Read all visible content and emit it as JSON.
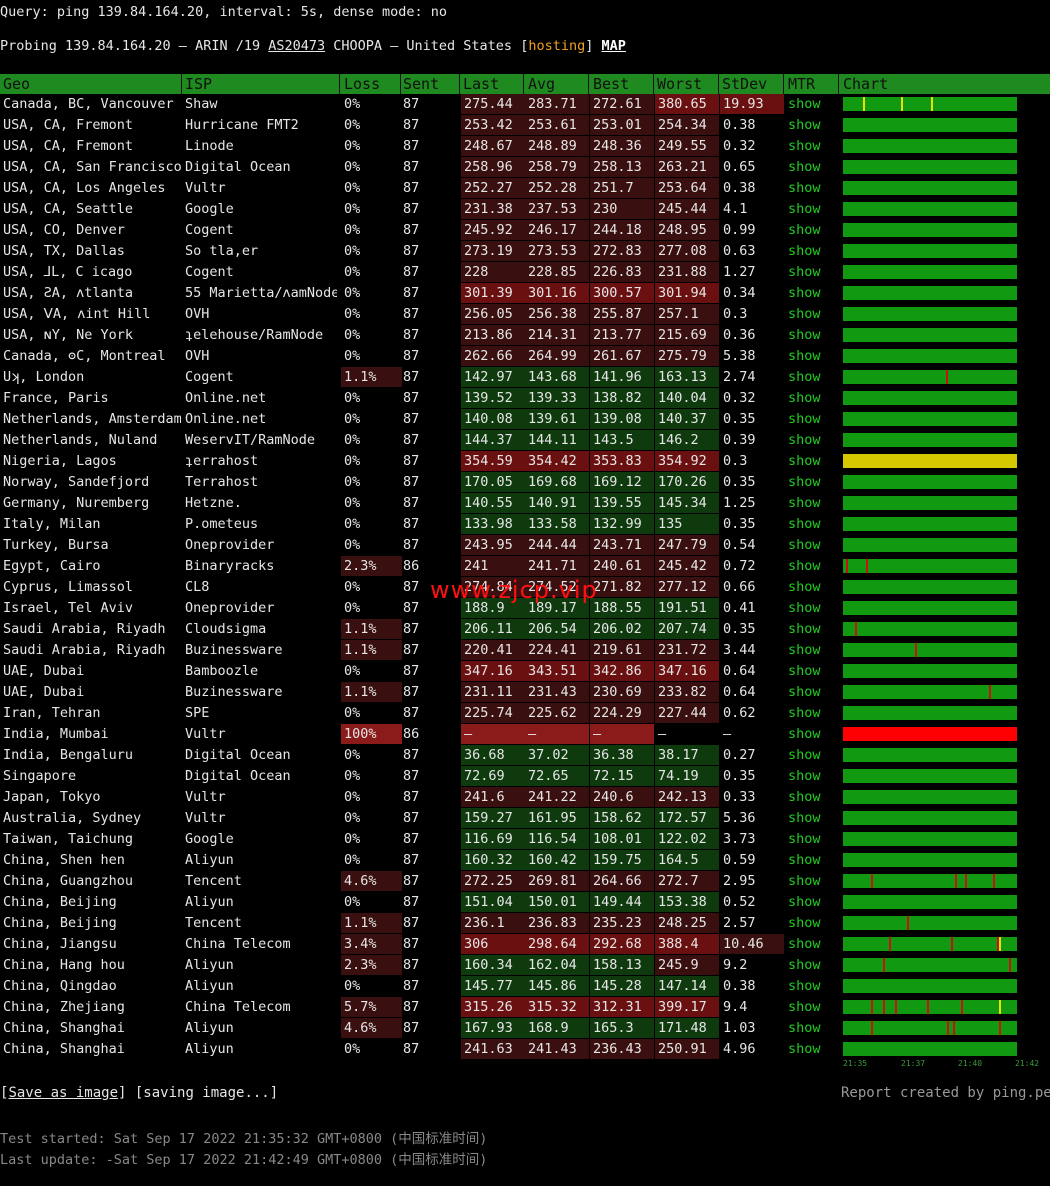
{
  "query": "Query: ping 139.84.164.20, interval: 5s, dense mode: no",
  "probe": {
    "prefix": "Probing 139.84.164.20 — ARIN /19 ",
    "asn": "AS20473",
    "mid": " CHOOPA — United States [",
    "tag": "hosting",
    "suffix": "] ",
    "map": "MAP"
  },
  "columns": [
    "Geo",
    "ISP",
    "Loss",
    "Sent",
    "Last",
    "Avg",
    "Best",
    "Worst",
    "StDev",
    "MTR",
    "Chart"
  ],
  "colors": {
    "good": "#0e3a0e",
    "mid": "#3a0f0f",
    "bad": "#6b1010",
    "worse": "#8b1a1a",
    "green": "#119911",
    "yellow": "#d4c800",
    "red": "#ff0000"
  },
  "rows": [
    {
      "geo": "Canada, BC, Vancouver",
      "isp": "Shaw",
      "loss": "0%",
      "sent": "87",
      "last": "275.44",
      "avg": "283.71",
      "best": "272.61",
      "worst": "380.65",
      "std": "19.93",
      "mtr": "show",
      "lc": "mid",
      "wc": "bad",
      "sc": "bad",
      "bar": "green",
      "spikes": [
        [
          20,
          "yellow"
        ],
        [
          58,
          "yellow"
        ],
        [
          88,
          "yellow"
        ]
      ]
    },
    {
      "geo": "USA, CA, Fremont",
      "isp": "Hurricane FMT2",
      "loss": "0%",
      "sent": "87",
      "last": "253.42",
      "avg": "253.61",
      "best": "253.01",
      "worst": "254.34",
      "std": "0.38",
      "mtr": "show",
      "lc": "mid",
      "wc": "mid",
      "bar": "green",
      "spikes": []
    },
    {
      "geo": "USA, CA, Fremont",
      "isp": "Linode",
      "loss": "0%",
      "sent": "87",
      "last": "248.67",
      "avg": "248.89",
      "best": "248.36",
      "worst": "249.55",
      "std": "0.32",
      "mtr": "show",
      "lc": "mid",
      "wc": "mid",
      "bar": "green",
      "spikes": []
    },
    {
      "geo": "USA, CA, San Francisco",
      "isp": "Digital Ocean",
      "loss": "0%",
      "sent": "87",
      "last": "258.96",
      "avg": "258.79",
      "best": "258.13",
      "worst": "263.21",
      "std": "0.65",
      "mtr": "show",
      "lc": "mid",
      "wc": "mid",
      "bar": "green",
      "spikes": []
    },
    {
      "geo": "USA, CA, Los Angeles",
      "isp": "Vultr",
      "loss": "0%",
      "sent": "87",
      "last": "252.27",
      "avg": "252.28",
      "best": "251.7",
      "worst": "253.64",
      "std": "0.38",
      "mtr": "show",
      "lc": "mid",
      "wc": "mid",
      "bar": "green",
      "spikes": []
    },
    {
      "geo": "USA, CA, Seattle",
      "isp": "Google",
      "loss": "0%",
      "sent": "87",
      "last": "231.38",
      "avg": "237.53",
      "best": "230",
      "worst": "245.44",
      "std": "4.1",
      "mtr": "show",
      "lc": "mid",
      "wc": "mid",
      "bar": "green",
      "spikes": []
    },
    {
      "geo": "USA, CO, Denver",
      "isp": "Cogent",
      "loss": "0%",
      "sent": "87",
      "last": "245.92",
      "avg": "246.17",
      "best": "244.18",
      "worst": "248.95",
      "std": "0.99",
      "mtr": "show",
      "lc": "mid",
      "wc": "mid",
      "bar": "green",
      "spikes": []
    },
    {
      "geo": "USA, TX, Dallas",
      "isp": "So tla,er",
      "loss": "0%",
      "sent": "87",
      "last": "273.19",
      "avg": "273.53",
      "best": "272.83",
      "worst": "277.08",
      "std": "0.63",
      "mtr": "show",
      "lc": "mid",
      "wc": "mid",
      "bar": "green",
      "spikes": []
    },
    {
      "geo": "USA, ⅃L, C icago",
      "isp": "Cogent",
      "loss": "0%",
      "sent": "87",
      "last": "228",
      "avg": "228.85",
      "best": "226.83",
      "worst": "231.88",
      "std": "1.27",
      "mtr": "show",
      "lc": "mid",
      "wc": "mid",
      "bar": "green",
      "spikes": []
    },
    {
      "geo": "USA, ƧA, ʌtlanta",
      "isp": "55 Marietta/ʌamNode",
      "loss": "0%",
      "sent": "87",
      "last": "301.39",
      "avg": "301.16",
      "best": "300.57",
      "worst": "301.94",
      "std": "0.34",
      "mtr": "show",
      "lc": "bad",
      "wc": "bad",
      "bar": "green",
      "spikes": []
    },
    {
      "geo": "USA, ⅤA, ʌint Hill",
      "isp": "OVH",
      "loss": "0%",
      "sent": "87",
      "last": "256.05",
      "avg": "256.38",
      "best": "255.87",
      "worst": "257.1",
      "std": "0.3",
      "mtr": "show",
      "lc": "mid",
      "wc": "mid",
      "bar": "green",
      "spikes": []
    },
    {
      "geo": "USA, ɴY, Ne  York",
      "isp": "ʇelehouse/RamNode",
      "loss": "0%",
      "sent": "87",
      "last": "213.86",
      "avg": "214.31",
      "best": "213.77",
      "worst": "215.69",
      "std": "0.36",
      "mtr": "show",
      "lc": "mid",
      "wc": "mid",
      "bar": "green",
      "spikes": []
    },
    {
      "geo": "Canada, ʘC, Montreal",
      "isp": "OVH",
      "loss": "0%",
      "sent": "87",
      "last": "262.66",
      "avg": "264.99",
      "best": "261.67",
      "worst": "275.79",
      "std": "5.38",
      "mtr": "show",
      "lc": "mid",
      "wc": "mid",
      "bar": "green",
      "spikes": []
    },
    {
      "geo": "Uʞ, London",
      "isp": "Cogent",
      "loss": "1.1%",
      "sent": "87",
      "last": "142.97",
      "avg": "143.68",
      "best": "141.96",
      "worst": "163.13",
      "std": "2.74",
      "mtr": "show",
      "lc": "good",
      "wc": "good",
      "lossc": "mid",
      "bar": "green",
      "spikes": [
        [
          103,
          "red"
        ]
      ]
    },
    {
      "geo": "France, Paris",
      "isp": "Online.net",
      "loss": "0%",
      "sent": "87",
      "last": "139.52",
      "avg": "139.33",
      "best": "138.82",
      "worst": "140.04",
      "std": "0.32",
      "mtr": "show",
      "lc": "good",
      "wc": "good",
      "bar": "green",
      "spikes": []
    },
    {
      "geo": "Netherlands, Amsterdam",
      "isp": "Online.net",
      "loss": "0%",
      "sent": "87",
      "last": "140.08",
      "avg": "139.61",
      "best": "139.08",
      "worst": "140.37",
      "std": "0.35",
      "mtr": "show",
      "lc": "good",
      "wc": "good",
      "bar": "green",
      "spikes": []
    },
    {
      "geo": "Netherlands, Nuland",
      "isp": "WeservIT/RamNode",
      "loss": "0%",
      "sent": "87",
      "last": "144.37",
      "avg": "144.11",
      "best": "143.5",
      "worst": "146.2",
      "std": "0.39",
      "mtr": "show",
      "lc": "good",
      "wc": "good",
      "bar": "green",
      "spikes": []
    },
    {
      "geo": "Nigeria, Lagos",
      "isp": "ʇerrahost",
      "loss": "0%",
      "sent": "87",
      "last": "354.59",
      "avg": "354.42",
      "best": "353.83",
      "worst": "354.92",
      "std": "0.3",
      "mtr": "show",
      "lc": "bad",
      "wc": "bad",
      "bar": "yellow",
      "spikes": []
    },
    {
      "geo": "Norway, Sandefjord",
      "isp": "Terrahost",
      "loss": "0%",
      "sent": "87",
      "last": "170.05",
      "avg": "169.68",
      "best": "169.12",
      "worst": "170.26",
      "std": "0.35",
      "mtr": "show",
      "lc": "good",
      "wc": "good",
      "bar": "green",
      "spikes": []
    },
    {
      "geo": "Germany, Nuremberg",
      "isp": "Hetzne.",
      "loss": "0%",
      "sent": "87",
      "last": "140.55",
      "avg": "140.91",
      "best": "139.55",
      "worst": "145.34",
      "std": "1.25",
      "mtr": "show",
      "lc": "good",
      "wc": "good",
      "bar": "green",
      "spikes": []
    },
    {
      "geo": "Italy, Milan",
      "isp": "P.ometeus",
      "loss": "0%",
      "sent": "87",
      "last": "133.98",
      "avg": "133.58",
      "best": "132.99",
      "worst": "135",
      "std": "0.35",
      "mtr": "show",
      "lc": "good",
      "wc": "good",
      "bar": "green",
      "spikes": []
    },
    {
      "geo": "Turkey, Bursa",
      "isp": "Oneprovider",
      "loss": "0%",
      "sent": "87",
      "last": "243.95",
      "avg": "244.44",
      "best": "243.71",
      "worst": "247.79",
      "std": "0.54",
      "mtr": "show",
      "lc": "mid",
      "wc": "mid",
      "bar": "green",
      "spikes": []
    },
    {
      "geo": "Egypt, Cairo",
      "isp": "Binaryracks",
      "loss": "2.3%",
      "sent": "86",
      "last": "241",
      "avg": "241.71",
      "best": "240.61",
      "worst": "245.42",
      "std": "0.72",
      "mtr": "show",
      "lc": "mid",
      "wc": "mid",
      "lossc": "mid",
      "bar": "green",
      "spikes": [
        [
          3,
          "red"
        ],
        [
          23,
          "red"
        ]
      ]
    },
    {
      "geo": "Cyprus, Limassol",
      "isp": "CL8",
      "loss": "0%",
      "sent": "87",
      "last": "274.84",
      "avg": "274.52",
      "best": "271.82",
      "worst": "277.12",
      "std": "0.66",
      "mtr": "show",
      "lc": "mid",
      "wc": "mid",
      "bar": "green",
      "spikes": []
    },
    {
      "geo": "Israel, Tel Aviv",
      "isp": "Oneprovider",
      "loss": "0%",
      "sent": "87",
      "last": "188.9",
      "avg": "189.17",
      "best": "188.55",
      "worst": "191.51",
      "std": "0.41",
      "mtr": "show",
      "lc": "good",
      "wc": "good",
      "bar": "green",
      "spikes": []
    },
    {
      "geo": "Saudi Arabia, Riyadh",
      "isp": "Cloudsigma",
      "loss": "1.1%",
      "sent": "87",
      "last": "206.11",
      "avg": "206.54",
      "best": "206.02",
      "worst": "207.74",
      "std": "0.35",
      "mtr": "show",
      "lc": "good",
      "wc": "good",
      "lossc": "mid",
      "bar": "green",
      "spikes": [
        [
          12,
          "red"
        ]
      ]
    },
    {
      "geo": "Saudi Arabia, Riyadh",
      "isp": "Buzinessware",
      "loss": "1.1%",
      "sent": "87",
      "last": "220.41",
      "avg": "224.41",
      "best": "219.61",
      "worst": "231.72",
      "std": "3.44",
      "mtr": "show",
      "lc": "mid",
      "wc": "mid",
      "lossc": "mid",
      "bar": "green",
      "spikes": [
        [
          72,
          "red"
        ]
      ]
    },
    {
      "geo": "UAE, Dubai",
      "isp": "Bamboozle",
      "loss": "0%",
      "sent": "87",
      "last": "347.16",
      "avg": "343.51",
      "best": "342.86",
      "worst": "347.16",
      "std": "0.64",
      "mtr": "show",
      "lc": "bad",
      "wc": "bad",
      "bar": "green",
      "spikes": []
    },
    {
      "geo": "UAE, Dubai",
      "isp": "Buzinessware",
      "loss": "1.1%",
      "sent": "87",
      "last": "231.11",
      "avg": "231.43",
      "best": "230.69",
      "worst": "233.82",
      "std": "0.64",
      "mtr": "show",
      "lc": "mid",
      "wc": "mid",
      "lossc": "mid",
      "bar": "green",
      "spikes": [
        [
          146,
          "red"
        ]
      ]
    },
    {
      "geo": "Iran, Tehran",
      "isp": "SPE",
      "loss": "0%",
      "sent": "87",
      "last": "225.74",
      "avg": "225.62",
      "best": "224.29",
      "worst": "227.44",
      "std": "0.62",
      "mtr": "show",
      "lc": "mid",
      "wc": "mid",
      "bar": "green",
      "spikes": []
    },
    {
      "geo": "India, Mumbai",
      "isp": "Vultr",
      "loss": "100%",
      "sent": "86",
      "last": "—",
      "avg": "—",
      "best": "—",
      "worst": "—",
      "std": "—",
      "mtr": "show",
      "lc": "worse",
      "wc": "none",
      "lossc": "worse",
      "bar": "red",
      "spikes": []
    },
    {
      "geo": "India, Bengaluru",
      "isp": "Digital Ocean",
      "loss": "0%",
      "sent": "87",
      "last": "36.68",
      "avg": "37.02",
      "best": "36.38",
      "worst": "38.17",
      "std": "0.27",
      "mtr": "show",
      "lc": "good",
      "wc": "good",
      "bar": "green",
      "spikes": []
    },
    {
      "geo": "Singapore",
      "isp": "Digital Ocean",
      "loss": "0%",
      "sent": "87",
      "last": "72.69",
      "avg": "72.65",
      "best": "72.15",
      "worst": "74.19",
      "std": "0.35",
      "mtr": "show",
      "lc": "good",
      "wc": "good",
      "bar": "green",
      "spikes": []
    },
    {
      "geo": "Japan, Tokyo",
      "isp": "Vultr",
      "loss": "0%",
      "sent": "87",
      "last": "241.6",
      "avg": "241.22",
      "best": "240.6",
      "worst": "242.13",
      "std": "0.33",
      "mtr": "show",
      "lc": "mid",
      "wc": "mid",
      "bar": "green",
      "spikes": []
    },
    {
      "geo": "Australia, Sydney",
      "isp": "Vultr",
      "loss": "0%",
      "sent": "87",
      "last": "159.27",
      "avg": "161.95",
      "best": "158.62",
      "worst": "172.57",
      "std": "5.36",
      "mtr": "show",
      "lc": "good",
      "wc": "good",
      "bar": "green",
      "spikes": []
    },
    {
      "geo": "Taiwan, Taichung",
      "isp": "Google",
      "loss": "0%",
      "sent": "87",
      "last": "116.69",
      "avg": "116.54",
      "best": "108.01",
      "worst": "122.02",
      "std": "3.73",
      "mtr": "show",
      "lc": "good",
      "wc": "good",
      "bar": "green",
      "spikes": []
    },
    {
      "geo": "China, Shen hen",
      "isp": "Aliyun",
      "loss": "0%",
      "sent": "87",
      "last": "160.32",
      "avg": "160.42",
      "best": "159.75",
      "worst": "164.5",
      "std": "0.59",
      "mtr": "show",
      "lc": "good",
      "wc": "good",
      "bar": "green",
      "spikes": []
    },
    {
      "geo": "China, Guangzhou",
      "isp": "Tencent",
      "loss": "4.6%",
      "sent": "87",
      "last": "272.25",
      "avg": "269.81",
      "best": "264.66",
      "worst": "272.7",
      "std": "2.95",
      "mtr": "show",
      "lc": "mid",
      "wc": "mid",
      "lossc": "mid",
      "bar": "green",
      "spikes": [
        [
          28,
          "red"
        ],
        [
          112,
          "red"
        ],
        [
          122,
          "red"
        ],
        [
          150,
          "red"
        ]
      ]
    },
    {
      "geo": "China, Beijing",
      "isp": "Aliyun",
      "loss": "0%",
      "sent": "87",
      "last": "151.04",
      "avg": "150.01",
      "best": "149.44",
      "worst": "153.38",
      "std": "0.52",
      "mtr": "show",
      "lc": "good",
      "wc": "good",
      "bar": "green",
      "spikes": []
    },
    {
      "geo": "China, Beijing",
      "isp": "Tencent",
      "loss": "1.1%",
      "sent": "87",
      "last": "236.1",
      "avg": "236.83",
      "best": "235.23",
      "worst": "248.25",
      "std": "2.57",
      "mtr": "show",
      "lc": "mid",
      "wc": "mid",
      "lossc": "mid",
      "bar": "green",
      "spikes": [
        [
          64,
          "red"
        ]
      ]
    },
    {
      "geo": "China, Jiangsu",
      "isp": "China Telecom",
      "loss": "3.4%",
      "sent": "87",
      "last": "306",
      "avg": "298.64",
      "best": "292.68",
      "worst": "388.4",
      "std": "10.46",
      "mtr": "show",
      "lc": "bad",
      "wc": "bad",
      "sc": "mid",
      "lossc": "mid",
      "bar": "green",
      "spikes": [
        [
          46,
          "red"
        ],
        [
          108,
          "red"
        ],
        [
          154,
          "red"
        ],
        [
          156,
          "yellow"
        ]
      ]
    },
    {
      "geo": "China, Hang hou",
      "isp": "Aliyun",
      "loss": "2.3%",
      "sent": "87",
      "last": "160.34",
      "avg": "162.04",
      "best": "158.13",
      "worst": "245.9",
      "std": "9.2",
      "mtr": "show",
      "lc": "good",
      "wc": "mid",
      "lossc": "mid",
      "bar": "green",
      "spikes": [
        [
          40,
          "red"
        ],
        [
          166,
          "red"
        ]
      ]
    },
    {
      "geo": "China, Qingdao",
      "isp": "Aliyun",
      "loss": "0%",
      "sent": "87",
      "last": "145.77",
      "avg": "145.86",
      "best": "145.28",
      "worst": "147.14",
      "std": "0.38",
      "mtr": "show",
      "lc": "good",
      "wc": "good",
      "bar": "green",
      "spikes": []
    },
    {
      "geo": "China, Zhejiang",
      "isp": "China Telecom",
      "loss": "5.7%",
      "sent": "87",
      "last": "315.26",
      "avg": "315.32",
      "best": "312.31",
      "worst": "399.17",
      "std": "9.4",
      "mtr": "show",
      "lc": "bad",
      "wc": "bad",
      "lossc": "mid",
      "bar": "green",
      "spikes": [
        [
          28,
          "red"
        ],
        [
          40,
          "red"
        ],
        [
          52,
          "red"
        ],
        [
          84,
          "red"
        ],
        [
          118,
          "red"
        ],
        [
          156,
          "yellow"
        ]
      ]
    },
    {
      "geo": "China, Shanghai",
      "isp": "Aliyun",
      "loss": "4.6%",
      "sent": "87",
      "last": "167.93",
      "avg": "168.9",
      "best": "165.3",
      "worst": "171.48",
      "std": "1.03",
      "mtr": "show",
      "lc": "good",
      "wc": "good",
      "lossc": "mid",
      "bar": "green",
      "spikes": [
        [
          28,
          "red"
        ],
        [
          104,
          "red"
        ],
        [
          110,
          "red"
        ],
        [
          156,
          "red"
        ]
      ]
    },
    {
      "geo": "China, Shanghai",
      "isp": "Aliyun",
      "loss": "0%",
      "sent": "87",
      "last": "241.63",
      "avg": "241.43",
      "best": "236.43",
      "worst": "250.91",
      "std": "4.96",
      "mtr": "show",
      "lc": "mid",
      "wc": "mid",
      "bar": "green",
      "spikes": []
    }
  ],
  "time_axis": [
    "21:35",
    "21:37",
    "21:40",
    "21:42"
  ],
  "watermark": "www.zjcp.vip",
  "save_label": "Save as image",
  "saving_label": "[saving image...]",
  "credit": "Report created by ping.pe",
  "test_started": "Test started: Sat Sep 17 2022 21:35:32 GMT+0800 (中国标准时间)",
  "last_update": "Last update: -Sat Sep 17 2022 21:42:49 GMT+0800 (中国标准时间)"
}
